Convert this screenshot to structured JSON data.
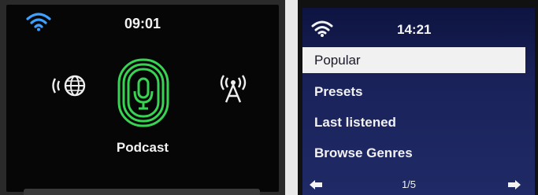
{
  "left_screen": {
    "time": "09:01",
    "selected_mode": "Podcast",
    "icons": [
      "wifi-icon",
      "internet-radio-icon",
      "podcast-microphone-icon",
      "radio-antenna-icon"
    ],
    "accent_color": "#39d353"
  },
  "right_screen": {
    "time": "14:21",
    "menu": [
      {
        "label": "Popular",
        "selected": true
      },
      {
        "label": "Presets",
        "selected": false
      },
      {
        "label": "Last listened",
        "selected": false
      },
      {
        "label": "Browse Genres",
        "selected": false
      }
    ],
    "page_indicator": "1/5",
    "icons": [
      "wifi-icon",
      "arrow-left-icon",
      "arrow-right-icon"
    ]
  }
}
